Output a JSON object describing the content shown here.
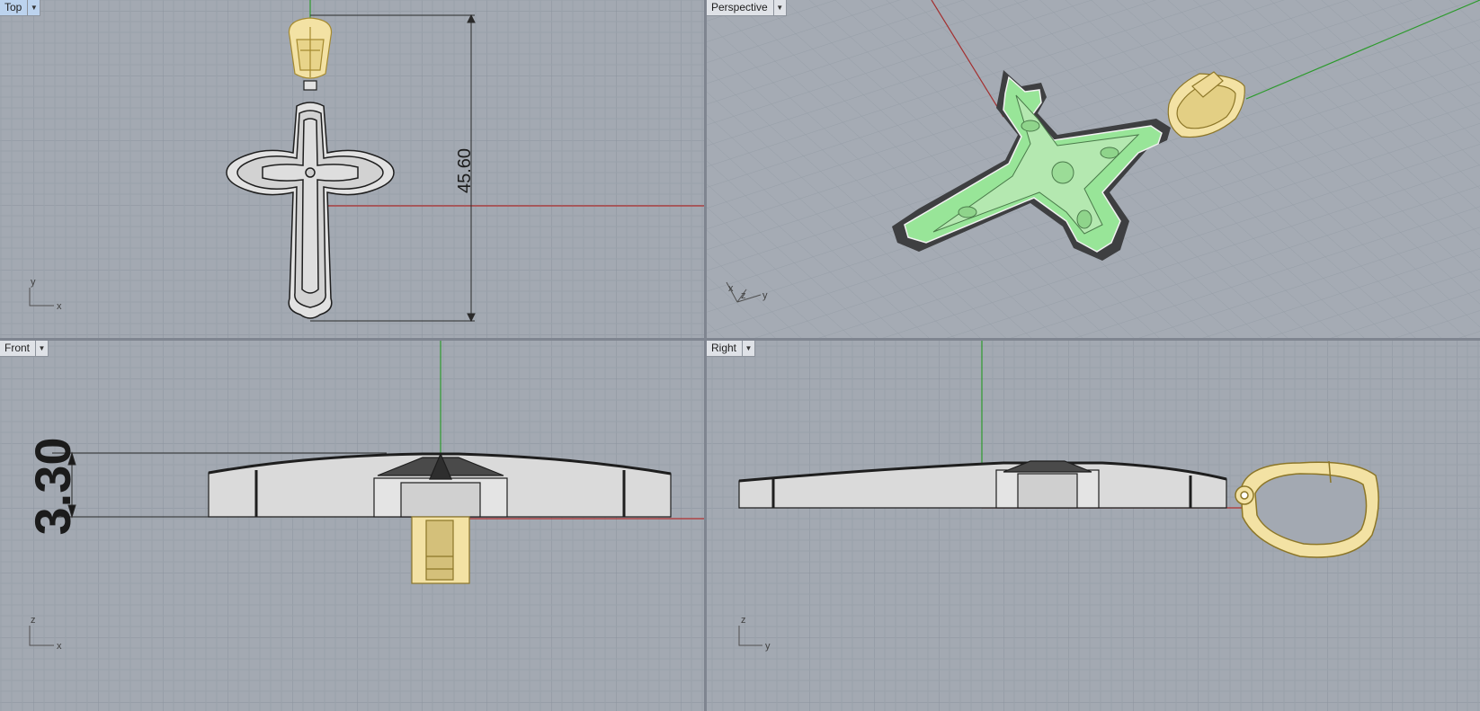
{
  "viewports": [
    {
      "id": "top",
      "name": "Top",
      "active": true
    },
    {
      "id": "perspective",
      "name": "Perspective",
      "active": false
    },
    {
      "id": "front",
      "name": "Front",
      "active": false
    },
    {
      "id": "right",
      "name": "Right",
      "active": false
    }
  ],
  "menu_icon": "chevron-down-icon",
  "dimensions": {
    "top_height": "45.60",
    "front_thickness": "3.30"
  },
  "axes": {
    "top": {
      "a": "y",
      "b": "x"
    },
    "perspective": {
      "a": "z",
      "b": "x",
      "c": "y"
    },
    "front": {
      "a": "z",
      "b": "x"
    },
    "right": {
      "a": "z",
      "b": "y"
    }
  },
  "colors": {
    "viewport_bg": "#a3a9b2",
    "grid_minor": "#98a0a9",
    "grid_major": "#8a929c",
    "x_axis": "#b03030",
    "y_axis": "#2d9a2d",
    "selected_gold": "#f3e2a4",
    "selected_green": "#9ee39a",
    "model_fill": "#dcdcdc",
    "model_dark": "#505050",
    "active_tab": "#bcd3ee"
  }
}
